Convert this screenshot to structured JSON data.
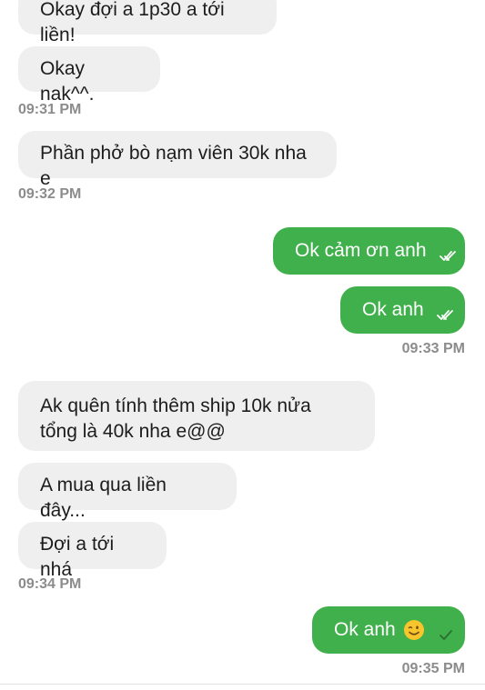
{
  "messages": [
    {
      "text": "Okay đợi a 1p30 a tới liền!"
    },
    {
      "text": "Okay nak^^."
    },
    {
      "text": "Phần phở bò nạm viên 30k nha e"
    },
    {
      "text": "Ok cảm ơn anh"
    },
    {
      "text": "Ok anh"
    },
    {
      "text": "Ak quên tính thêm ship 10k nửa tổng là 40k nha e@@"
    },
    {
      "text": "A mua qua liền đây..."
    },
    {
      "text": "Đợi a tới nhá"
    },
    {
      "text": "Ok anh",
      "emoji": "winking-face-emoji",
      "status": "delivered-check"
    }
  ],
  "timestamps": [
    "09:31 PM",
    "09:32 PM",
    "09:33 PM",
    "09:34 PM",
    "09:35 PM"
  ],
  "colors": {
    "outgoing_bubble": "#3fb04b",
    "incoming_bubble": "#efefef",
    "timestamp": "#8c8c8c"
  },
  "icons": {
    "read": "double-check-icon",
    "sent": "single-check-icon"
  }
}
